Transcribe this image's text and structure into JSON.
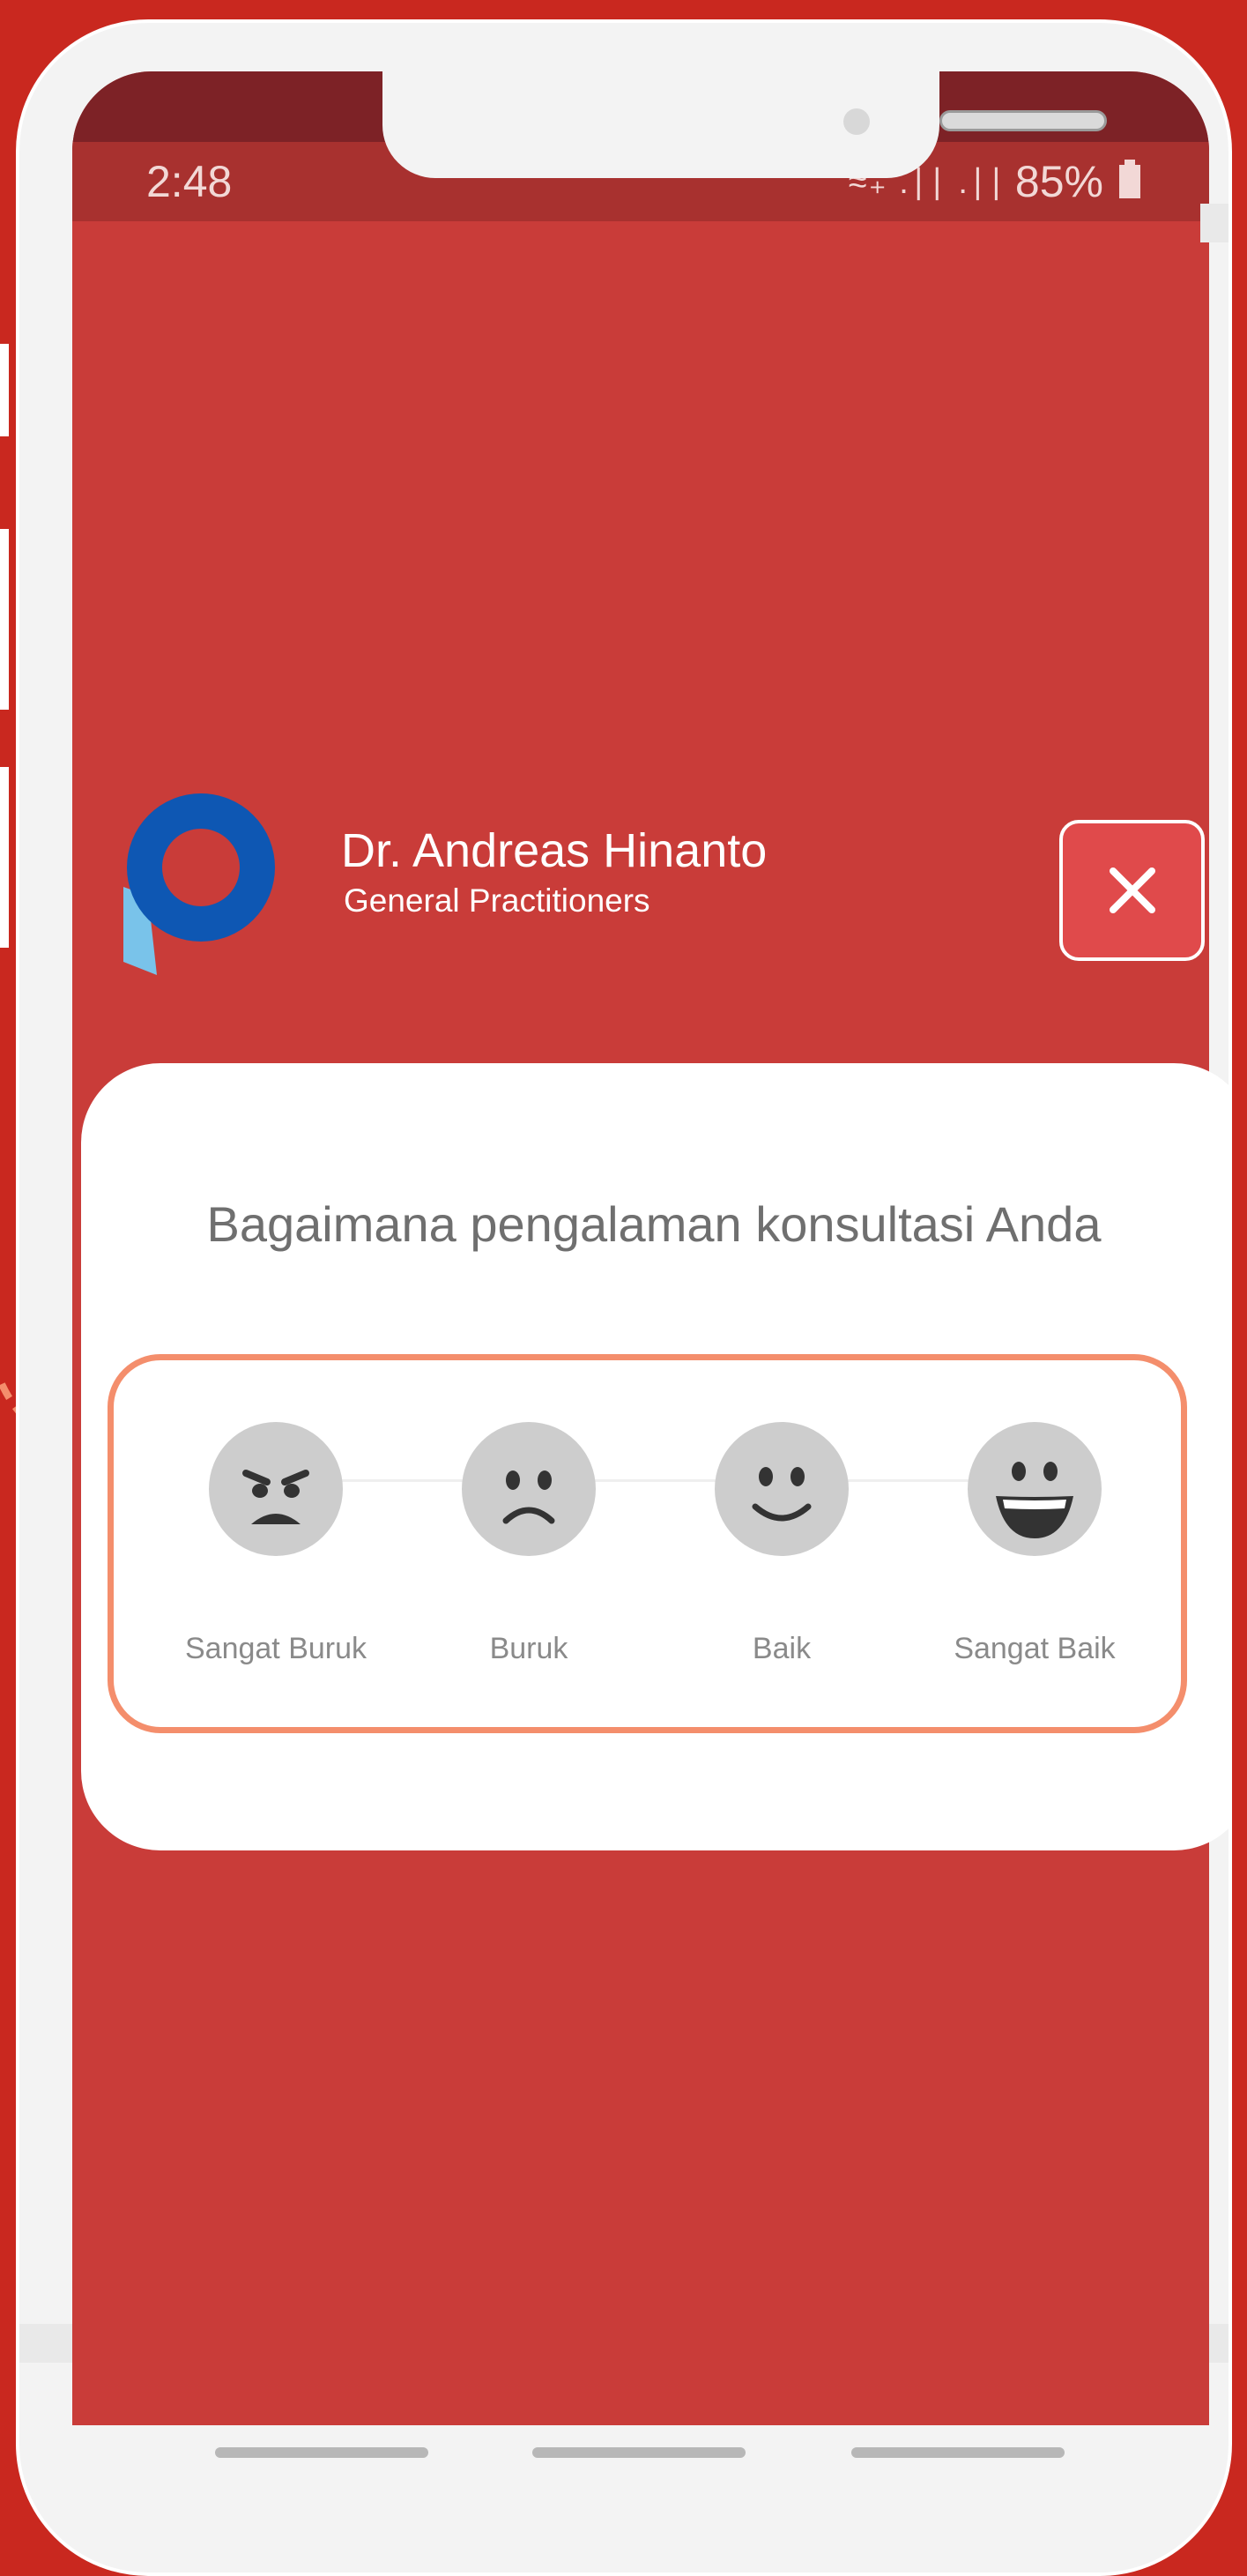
{
  "status_bar": {
    "time": "2:48",
    "signal_icons": "≈₊ .∣∣ .∣∣",
    "battery_percent": "85%"
  },
  "doctor": {
    "name": "Dr. Andreas Hinanto",
    "specialty": "General Practitioners"
  },
  "close_button": {
    "icon": "close-icon"
  },
  "rating": {
    "question": "Bagaimana pengalaman konsultasi Anda",
    "options": [
      {
        "label": "Sangat Buruk",
        "icon": "angry-face-icon"
      },
      {
        "label": "Buruk",
        "icon": "sad-face-icon"
      },
      {
        "label": "Baik",
        "icon": "smile-face-icon"
      },
      {
        "label": "Sangat Baik",
        "icon": "grin-face-icon"
      }
    ]
  },
  "colors": {
    "background": "#c9281f",
    "screen": "#c93c39",
    "highlight_border": "#f48e6c",
    "close_button": "#e04a4b",
    "logo_blue": "#0e57b3",
    "logo_light_blue": "#79c3ea"
  }
}
